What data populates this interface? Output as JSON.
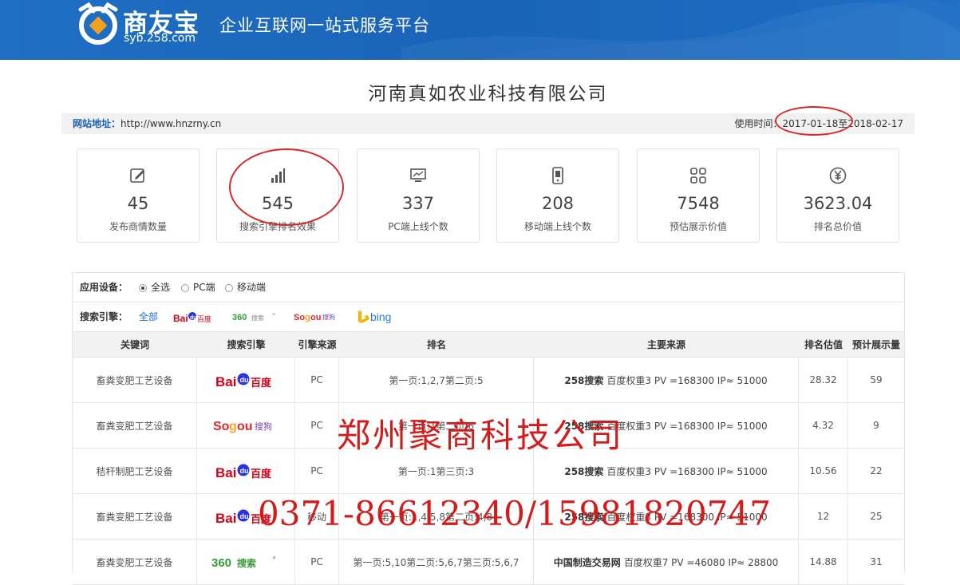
{
  "header": {
    "brand": "商友宝",
    "brand_sub": "syb.258.com",
    "slogan": "企业互联网一站式服务平台"
  },
  "company_name": "河南真如农业科技有限公司",
  "infobar": {
    "site_label": "网站地址：",
    "site_url": "http://www.hnzrny.cn",
    "time_label": "使用时间：",
    "time_range": "2017-01-18至2018-02-17"
  },
  "stats": [
    {
      "icon": "edit-icon",
      "value": "45",
      "label": "发布商情数量"
    },
    {
      "icon": "bar-chart-icon",
      "value": "545",
      "label": "搜索引擎排名效果"
    },
    {
      "icon": "monitor-icon",
      "value": "337",
      "label": "PC端上线个数"
    },
    {
      "icon": "mobile-icon",
      "value": "208",
      "label": "移动端上线个数"
    },
    {
      "icon": "grid-icon",
      "value": "7548",
      "label": "预估展示价值"
    },
    {
      "icon": "yen-icon",
      "value": "3623.04",
      "label": "排名总价值"
    }
  ],
  "filters": {
    "device_label": "应用设备：",
    "device_options": [
      "全选",
      "PC端",
      "移动端"
    ],
    "device_selected": "全选",
    "engine_label": "搜索引擎：",
    "engine_all": "全部",
    "engines": [
      "Bai百度",
      "360搜索",
      "Sogou搜狗",
      "bing"
    ]
  },
  "table": {
    "headers": [
      "关键词",
      "搜索引擎",
      "引擎来源",
      "排名",
      "主要来源",
      "排名估值",
      "预计展示量"
    ],
    "rows": [
      {
        "keyword": "畜粪变肥工艺设备",
        "engine": "baidu",
        "source": "PC",
        "rank": "第一页:1,2,7第二页:5",
        "main_site": "258搜索",
        "main_detail": "百度权重3 PV =168300 IP≈ 51000",
        "value": "28.32",
        "views": "59"
      },
      {
        "keyword": "畜粪变肥工艺设备",
        "engine": "sogou",
        "source": "PC",
        "rank": "第一页:1第二页:6",
        "main_site": "258搜索",
        "main_detail": "百度权重3 PV =168300 IP≈ 51000",
        "value": "4.32",
        "views": "9"
      },
      {
        "keyword": "秸秆制肥工艺设备",
        "engine": "baidu",
        "source": "PC",
        "rank": "第一页:1第三页:3",
        "main_site": "258搜索",
        "main_detail": "百度权重3 PV =168300 IP≈ 51000",
        "value": "10.56",
        "views": "22"
      },
      {
        "keyword": "畜粪变肥工艺设备",
        "engine": "baidu",
        "source": "移动",
        "rank": "第一页:1,4,5,8第二页:4,8",
        "main_site": "258搜索",
        "main_detail": "百度权重3 PV =168300 IP≈ 51000",
        "value": "12",
        "views": "25"
      },
      {
        "keyword": "畜粪变肥工艺设备",
        "engine": "360",
        "source": "PC",
        "rank": "第一页:5,10第二页:5,6,7第三页:5,6,7",
        "main_site": "中国制造交易网",
        "main_detail": "百度权重7 PV =46080 IP≈ 28800",
        "value": "14.88",
        "views": "31"
      }
    ]
  },
  "watermark": {
    "company": "郑州聚商科技公司",
    "phone": "0371-86612340/15981820747"
  },
  "colors": {
    "header_blue": "#1f6fc4",
    "annotation_red": "#d42a2a",
    "link_blue": "#1a6dd0"
  }
}
